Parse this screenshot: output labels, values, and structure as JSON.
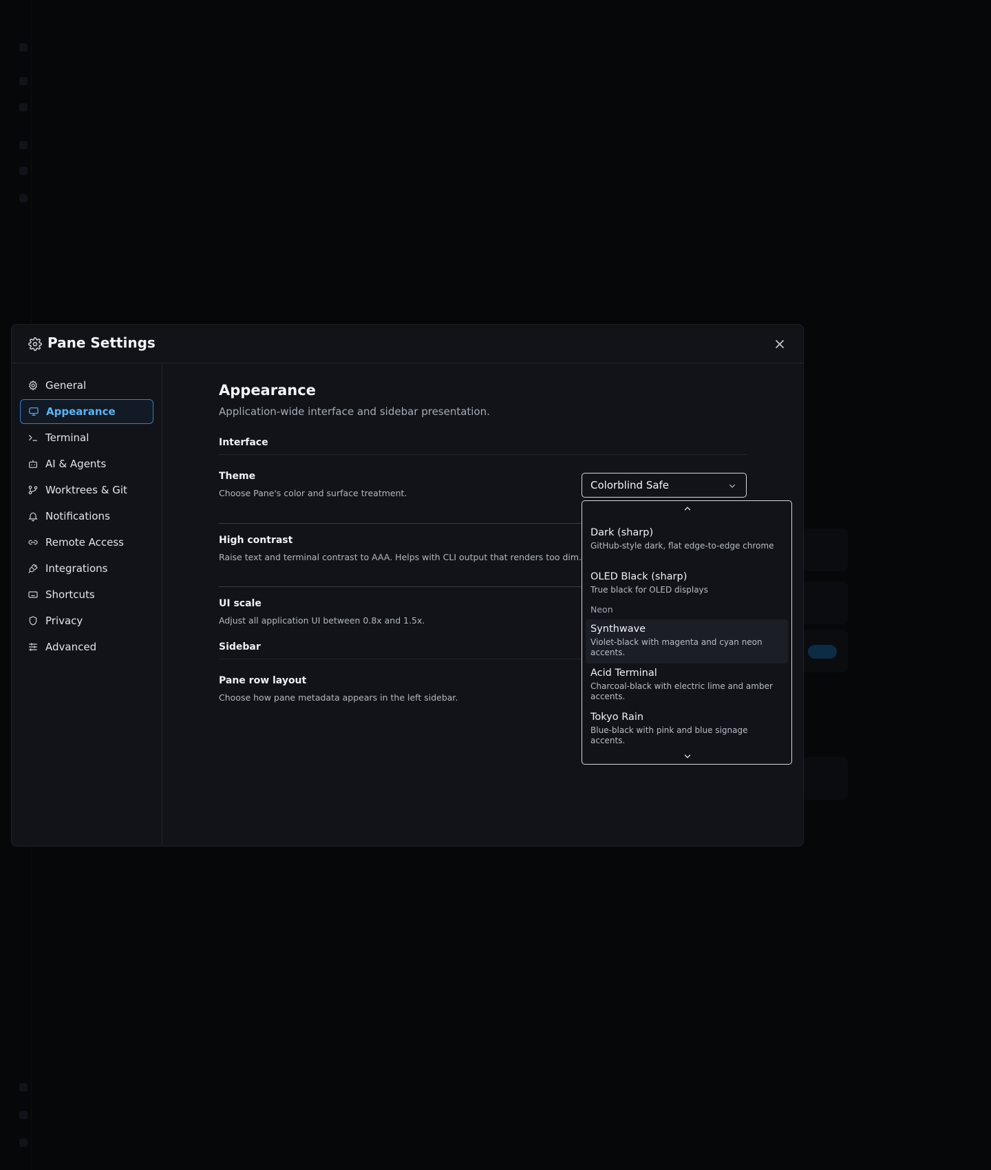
{
  "modal": {
    "title": "Pane Settings"
  },
  "nav": {
    "items": [
      {
        "label": "General",
        "icon": "gear-icon"
      },
      {
        "label": "Appearance",
        "icon": "monitor-icon",
        "active": true
      },
      {
        "label": "Terminal",
        "icon": "terminal-icon"
      },
      {
        "label": "AI & Agents",
        "icon": "robot-icon"
      },
      {
        "label": "Worktrees & Git",
        "icon": "git-branch-icon"
      },
      {
        "label": "Notifications",
        "icon": "bell-icon"
      },
      {
        "label": "Remote Access",
        "icon": "link-icon"
      },
      {
        "label": "Integrations",
        "icon": "plug-icon"
      },
      {
        "label": "Shortcuts",
        "icon": "keyboard-icon"
      },
      {
        "label": "Privacy",
        "icon": "shield-icon"
      },
      {
        "label": "Advanced",
        "icon": "sliders-icon"
      }
    ]
  },
  "content": {
    "title": "Appearance",
    "subtitle": "Application-wide interface and sidebar presentation.",
    "interface": {
      "heading": "Interface",
      "theme": {
        "label": "Theme",
        "desc": "Choose Pane's color and surface treatment.",
        "value": "Colorblind Safe"
      },
      "high_contrast": {
        "label": "High contrast",
        "desc": "Raise text and terminal contrast to AAA. Helps with CLI output that renders too dim."
      },
      "ui_scale": {
        "label": "UI scale",
        "desc": "Adjust all application UI between 0.8x and 1.5x."
      }
    },
    "sidebar": {
      "heading": "Sidebar",
      "pane_row_layout": {
        "label": "Pane row layout",
        "desc": "Choose how pane metadata appears in the left sidebar."
      }
    }
  },
  "dropdown": {
    "options": [
      {
        "name": "Dark (sharp)",
        "desc": "GitHub-style dark, flat edge-to-edge chrome"
      },
      {
        "name": "OLED Black (sharp)",
        "desc": "True black for OLED displays"
      }
    ],
    "group_label": "Neon",
    "neon_options": [
      {
        "name": "Synthwave",
        "desc": "Violet-black with magenta and cyan neon accents.",
        "highlighted": true
      },
      {
        "name": "Acid Terminal",
        "desc": "Charcoal-black with electric lime and amber accents."
      },
      {
        "name": "Tokyo Rain",
        "desc": "Blue-black with pink and blue signage accents."
      }
    ]
  },
  "colors": {
    "accent": "#5cb4f2",
    "accent_border": "#2f7fd0",
    "surface": "#111318",
    "backdrop": "#060709"
  }
}
